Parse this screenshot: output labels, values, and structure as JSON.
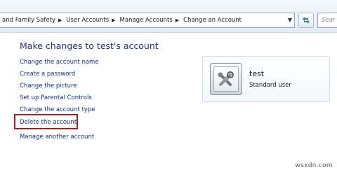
{
  "breadcrumb": {
    "items": [
      "and Family Safety",
      "User Accounts",
      "Manage Accounts",
      "Change an Account"
    ]
  },
  "search": {
    "placeholder": "Sear"
  },
  "icons": {
    "separator": "chevron-right-icon",
    "dropdown": "chevron-down-icon",
    "refresh": "refresh-icon",
    "avatar": "user-avatar-icon"
  },
  "main": {
    "heading": "Make changes to test's account",
    "tasks": [
      "Change the account name",
      "Create a password",
      "Change the picture",
      "Set up Parental Controls",
      "Change the account type",
      "Delete the account",
      "Manage another account"
    ]
  },
  "account": {
    "name": "test",
    "type": "Standard user"
  },
  "colors": {
    "link": "#0f2f90",
    "heading": "#1e3287",
    "highlight_border": "#b31b1b"
  },
  "watermark": "wsxdn.com"
}
